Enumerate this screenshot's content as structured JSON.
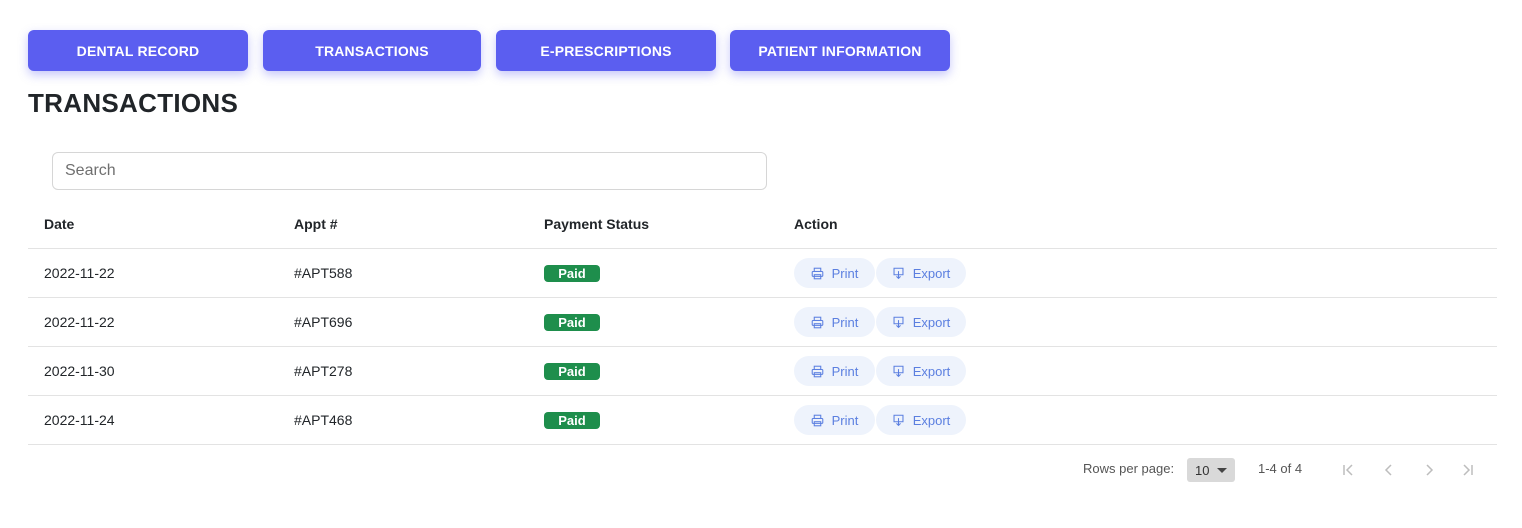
{
  "tabs": [
    {
      "label": "DENTAL RECORD"
    },
    {
      "label": "TRANSACTIONS"
    },
    {
      "label": "E-PRESCRIPTIONS"
    },
    {
      "label": "PATIENT INFORMATION"
    }
  ],
  "page_title": "TRANSACTIONS",
  "search": {
    "placeholder": "Search",
    "value": ""
  },
  "table": {
    "columns": [
      "Date",
      "Appt #",
      "Payment Status",
      "Action"
    ],
    "rows": [
      {
        "date": "2022-11-22",
        "appt": "#APT588",
        "status": "Paid",
        "print": "Print",
        "export": "Export"
      },
      {
        "date": "2022-11-22",
        "appt": "#APT696",
        "status": "Paid",
        "print": "Print",
        "export": "Export"
      },
      {
        "date": "2022-11-30",
        "appt": "#APT278",
        "status": "Paid",
        "print": "Print",
        "export": "Export"
      },
      {
        "date": "2022-11-24",
        "appt": "#APT468",
        "status": "Paid",
        "print": "Print",
        "export": "Export"
      }
    ]
  },
  "pagination": {
    "rows_per_page_label": "Rows per page:",
    "rows_per_page": "10",
    "range": "1-4 of 4"
  },
  "colors": {
    "tab_bg": "#5b5ef0",
    "paid_badge": "#1e8e4c",
    "action_text": "#5b7fe0",
    "action_bg": "#eef3fc"
  },
  "icons": {
    "print": "printer-icon",
    "export": "export-icon",
    "first": "first-page-icon",
    "prev": "prev-page-icon",
    "next": "next-page-icon",
    "last": "last-page-icon"
  }
}
